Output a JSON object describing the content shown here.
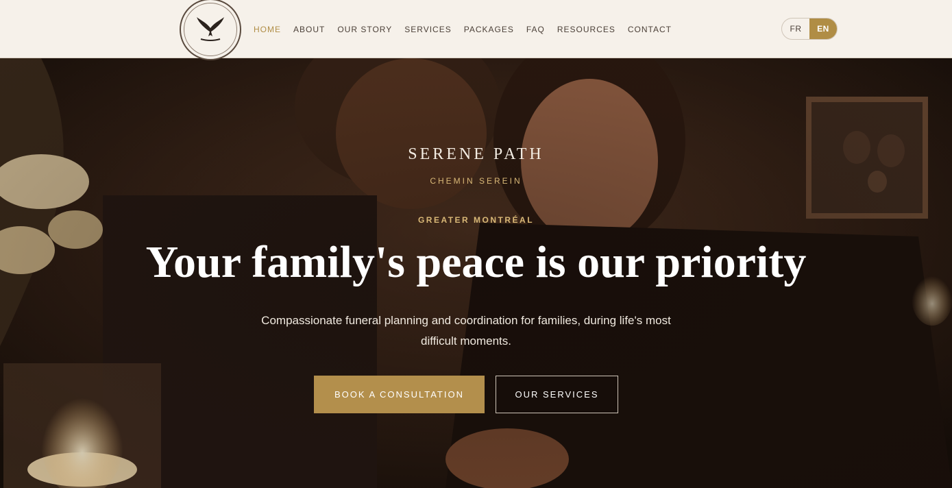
{
  "header": {
    "nav": [
      {
        "label": "HOME",
        "active": true
      },
      {
        "label": "ABOUT"
      },
      {
        "label": "OUR STORY"
      },
      {
        "label": "SERVICES"
      },
      {
        "label": "PACKAGES"
      },
      {
        "label": "FAQ"
      },
      {
        "label": "RESOURCES"
      },
      {
        "label": "CONTACT"
      }
    ],
    "lang": {
      "fr": "FR",
      "en": "EN",
      "selected": "EN"
    }
  },
  "hero": {
    "brand": "SERENE PATH",
    "brand_sub": "CHEMIN SEREIN",
    "location": "GREATER MONTRÉAL",
    "headline": "Your family's peace is our priority",
    "tagline": "Compassionate funeral planning and coordination for families, during life's most difficult moments.",
    "primary_button": "BOOK A CONSULTATION",
    "secondary_button": "OUR SERVICES"
  },
  "colors": {
    "accent": "#b08d45",
    "header_bg": "#f6f1ea",
    "hero_dark": "#1c120c",
    "gold_text": "#d9b877"
  }
}
